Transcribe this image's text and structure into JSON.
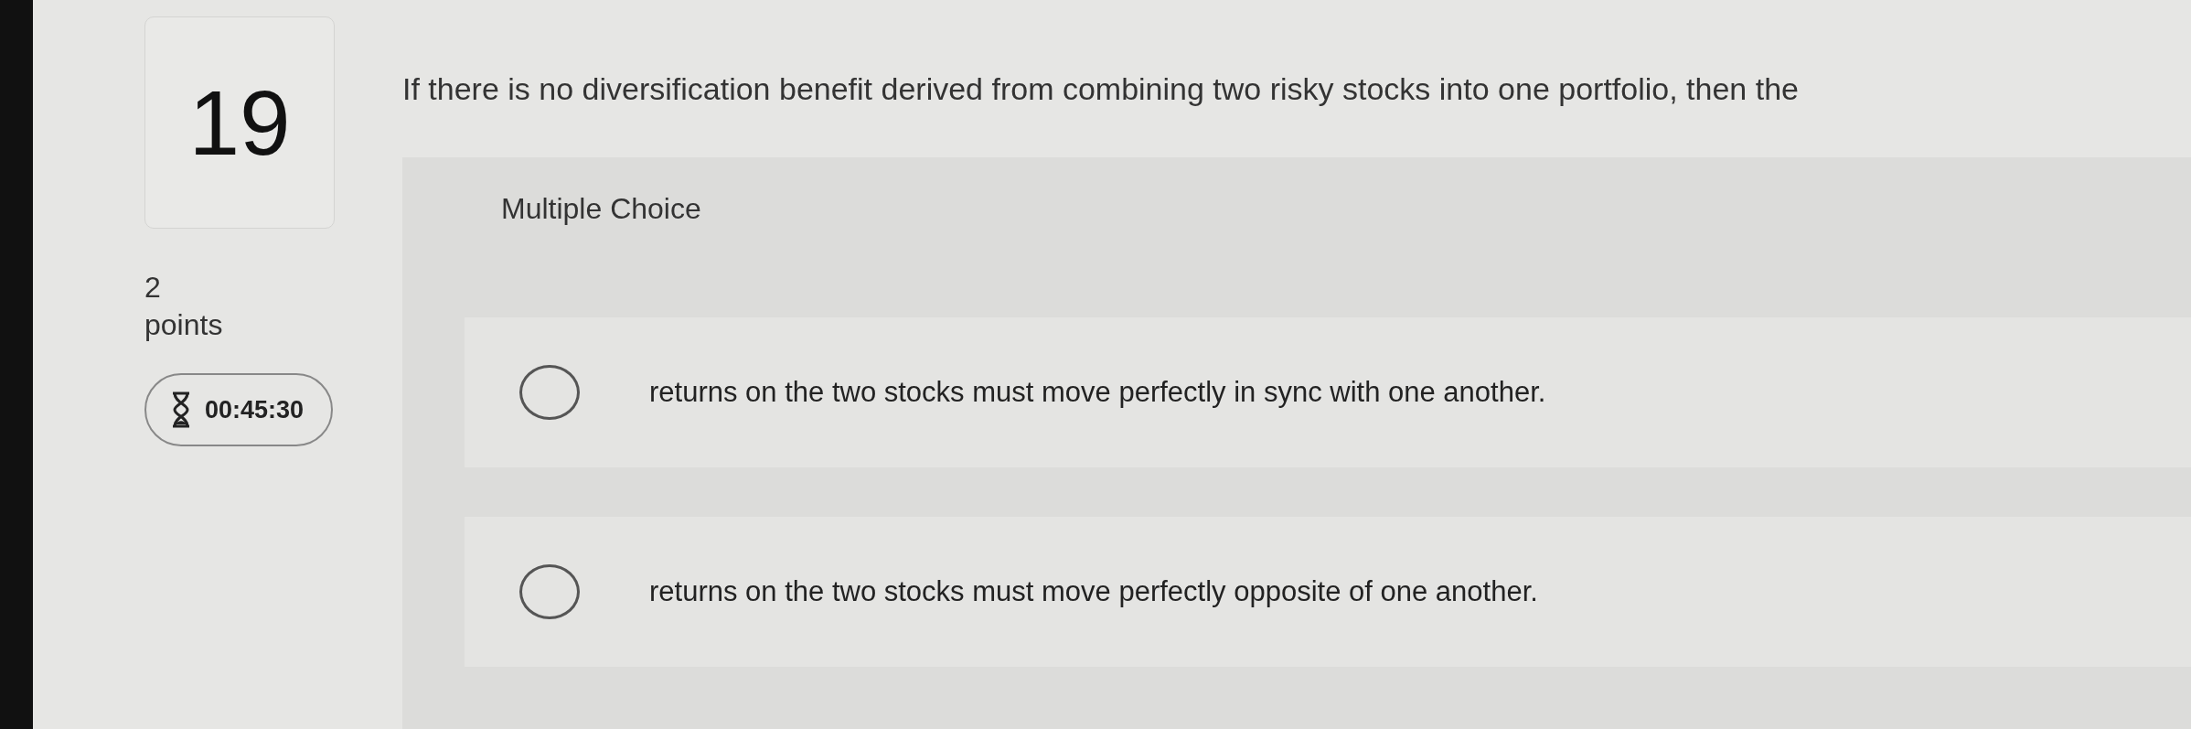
{
  "question": {
    "number": "19",
    "text": "If there is no diversification benefit derived from combining two risky stocks into one portfolio, then the",
    "points": "2",
    "points_label": "points",
    "timer": "00:45:30"
  },
  "answer": {
    "type_label": "Multiple Choice",
    "options": [
      {
        "text": "returns on the two stocks must move perfectly in sync with one another.",
        "selected": false
      },
      {
        "text": "returns on the two stocks must move perfectly opposite of one another.",
        "selected": false
      }
    ]
  }
}
